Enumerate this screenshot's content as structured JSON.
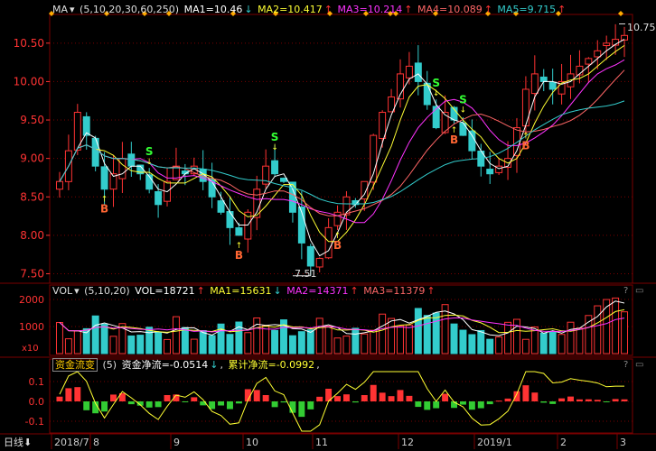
{
  "colors": {
    "up": "#ff3333",
    "down": "#33cccc",
    "grid": "#7a0000",
    "ma1": "#ffffff",
    "ma2": "#ffff33",
    "ma3": "#ff33ff",
    "ma4": "#ff6666",
    "ma5": "#33cccc",
    "axis_text": "#ff3333",
    "date_text": "#cccccc"
  },
  "price_panel": {
    "indicator_btn": "MA",
    "params": "(5,10,20,30,60,250)",
    "ma1": "MA1=10.46",
    "ma2": "MA2=10.417",
    "ma3": "MA3=10.214",
    "ma4": "MA4=10.089",
    "ma5": "MA5=9.715",
    "high_label": "10.75",
    "low_label": "7.51",
    "signal_s": "S",
    "signal_b": "B"
  },
  "vol_panel": {
    "indicator_btn": "VOL",
    "params": "(5,10,20)",
    "vol": "VOL=18721",
    "ma1": "MA1=15631",
    "ma2": "MA2=14371",
    "ma3": "MA3=11379",
    "unit": "x10"
  },
  "flow_panel": {
    "indicator_btn": "资金流变",
    "params": "(5)",
    "flow": "资金净流=-0.0514",
    "cumulative": "累计净流=-0.0992"
  },
  "controls": {
    "help": "?",
    "collapse": "▭"
  },
  "bottom": {
    "period": "日线",
    "dates": [
      "2018/7",
      "8",
      "9",
      "10",
      "11",
      "12",
      "2019/1",
      "2",
      "3"
    ]
  },
  "chart_data": [
    {
      "type": "line",
      "title": "",
      "y_ticks": [
        10.5,
        10.0,
        9.5,
        9.0,
        8.5,
        8.0,
        7.5
      ],
      "ylim": [
        7.4,
        10.85
      ],
      "x_ticks": [
        "2018/7",
        "8",
        "9",
        "10",
        "11",
        "12",
        "2019/1",
        "2",
        "3"
      ],
      "series": [
        {
          "name": "close",
          "values": [
            8.7,
            9.1,
            9.6,
            9.3,
            8.9,
            8.6,
            8.8,
            9.0,
            8.9,
            8.8,
            8.6,
            8.4,
            8.7,
            8.9,
            8.8,
            8.9,
            8.7,
            8.5,
            8.3,
            8.1,
            8.0,
            8.3,
            8.6,
            8.9,
            8.8,
            8.7,
            8.3,
            7.9,
            7.6,
            7.7,
            8.1,
            8.3,
            8.5,
            8.4,
            8.7,
            9.3,
            9.6,
            9.8,
            10.1,
            10.2,
            10.0,
            9.7,
            9.4,
            9.6,
            9.5,
            9.3,
            9.1,
            8.9,
            8.8,
            8.9,
            9.0,
            9.4,
            9.9,
            10.1,
            10.0,
            9.9,
            10.0,
            10.1,
            10.2,
            10.3,
            10.4,
            10.5,
            10.55,
            10.6
          ]
        }
      ]
    },
    {
      "type": "bar",
      "title": "",
      "y_ticks": [
        2000,
        1000
      ],
      "ylim": [
        0,
        2400
      ]
    },
    {
      "type": "bar",
      "title": "",
      "y_ticks": [
        0.1,
        0.0,
        -0.1
      ],
      "ylim": [
        -0.15,
        0.15
      ]
    }
  ]
}
